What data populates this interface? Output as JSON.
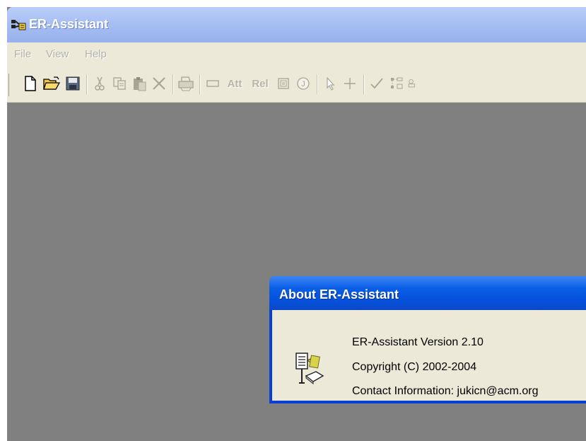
{
  "window": {
    "title": "ER-Assistant",
    "app_icon": "er-assistant-app-icon"
  },
  "menu": {
    "items": [
      {
        "label": "File"
      },
      {
        "label": "View"
      },
      {
        "label": "Help"
      }
    ],
    "state": "disabled"
  },
  "toolbar": {
    "state": "disabled",
    "buttons": [
      {
        "icon": "new-document-icon"
      },
      {
        "icon": "open-folder-icon"
      },
      {
        "icon": "save-icon"
      },
      {
        "icon": "cut-icon"
      },
      {
        "icon": "copy-icon"
      },
      {
        "icon": "paste-icon"
      },
      {
        "icon": "delete-icon"
      },
      {
        "icon": "print-icon"
      },
      {
        "icon": "entity-rectangle-icon"
      },
      {
        "label": "Att",
        "icon": "attribute-text-icon"
      },
      {
        "label": "Rel",
        "icon": "relationship-text-icon"
      },
      {
        "icon": "weak-entity-icon"
      },
      {
        "icon": "cardinality-icon"
      },
      {
        "icon": "pointer-arrow-icon"
      },
      {
        "icon": "crosshair-icon"
      },
      {
        "icon": "check-icon"
      },
      {
        "icon": "layout-icon"
      },
      {
        "icon": "partial-icon"
      }
    ]
  },
  "about_dialog": {
    "title": "About ER-Assistant",
    "icon": "er-diagram-document-icon",
    "lines": [
      "ER-Assistant Version 2.10",
      "Copyright (C) 2002-2004",
      "Contact Information: jukicn@acm.org"
    ]
  },
  "colors": {
    "workspace": "#808080",
    "menu_background": "#ece9d8",
    "dialog_title": "#0a5fe6"
  }
}
